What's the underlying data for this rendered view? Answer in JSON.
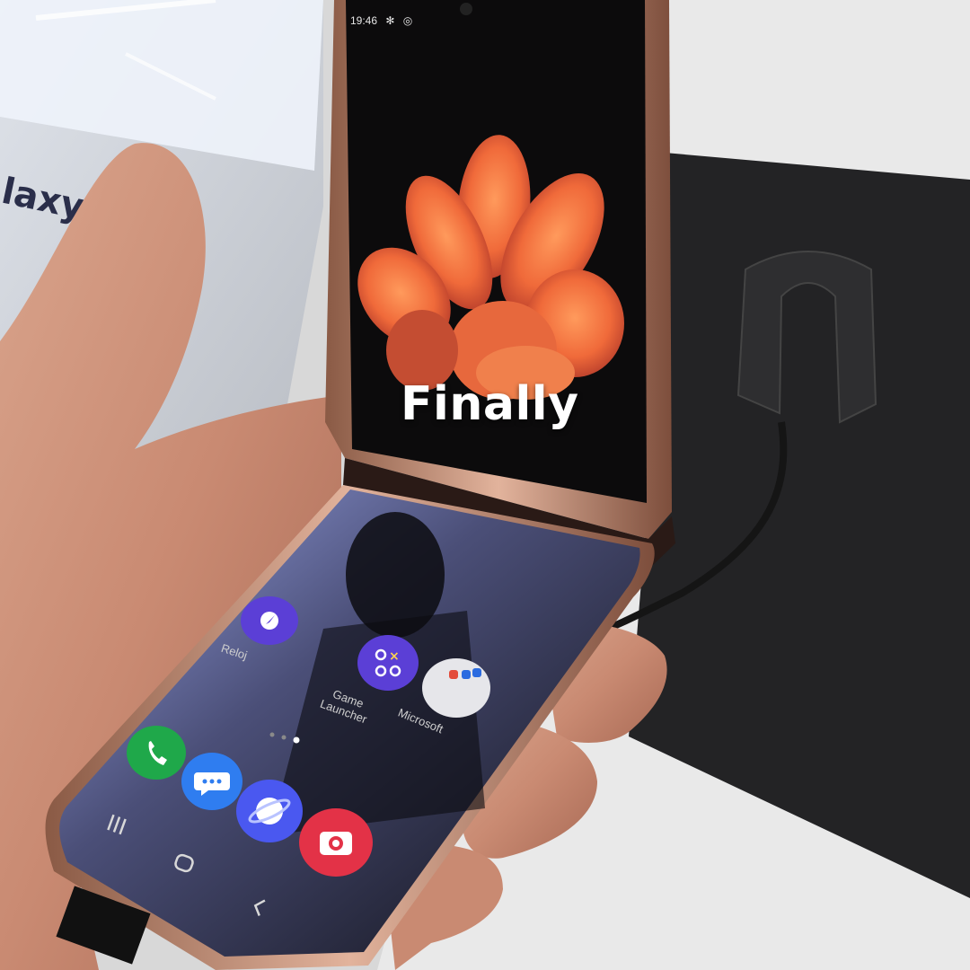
{
  "caption": "Finally",
  "status_bar": {
    "time": "19:46",
    "icons": [
      "sparkle-icon",
      "data-saver-icon"
    ]
  },
  "apps": [
    {
      "label": "Reloj",
      "icon": "clock-icon",
      "color": "#5b3fd6"
    },
    {
      "label": "Game\nLauncher",
      "icon": "game-launcher-icon",
      "color": "#5b3fd6"
    },
    {
      "label": "Microsoft",
      "icon": "folder-icon",
      "color": "#e6e6ea"
    }
  ],
  "dock": [
    {
      "icon": "phone-icon",
      "color": "#1fa84a"
    },
    {
      "icon": "messages-icon",
      "color": "#2f7df0"
    },
    {
      "icon": "internet-icon",
      "color": "#4a58f0"
    },
    {
      "icon": "camera-icon",
      "color": "#e33247"
    }
  ],
  "nav": [
    "recents-icon",
    "home-icon",
    "back-icon"
  ],
  "page_indicator": {
    "pages": 3,
    "current": 3
  },
  "background_text": "laxy Z"
}
